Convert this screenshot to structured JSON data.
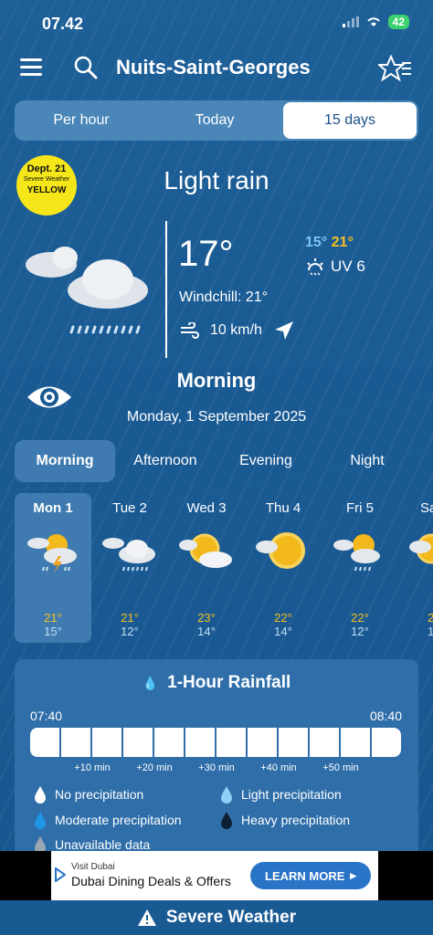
{
  "status": {
    "time": "07.42",
    "battery": "42"
  },
  "header": {
    "title": "Nuits-Saint-Georges"
  },
  "tabs": [
    "Per hour",
    "Today",
    "15 days"
  ],
  "badge": {
    "line1": "Dept. 21",
    "line2": "Severe Weather",
    "line3": "YELLOW",
    "color": "#f5e61a"
  },
  "current": {
    "condition": "Light rain",
    "temp": "17°",
    "min": "15°",
    "max": "21°",
    "uv": "UV 6",
    "windchill": "Windchill: 21°",
    "wind": "10 km/h"
  },
  "period": {
    "title": "Morning",
    "date": "Monday, 1 September 2025"
  },
  "period_tabs": [
    "Morning",
    "Afternoon",
    "Evening",
    "Night"
  ],
  "days": [
    {
      "name": "Mon 1",
      "max": "21°",
      "min": "15°",
      "icon": "storm-icon"
    },
    {
      "name": "Tue 2",
      "max": "21°",
      "min": "12°",
      "icon": "rain-cloud-icon"
    },
    {
      "name": "Wed 3",
      "max": "23°",
      "min": "14°",
      "icon": "partly-cloudy-icon"
    },
    {
      "name": "Thu 4",
      "max": "22°",
      "min": "14°",
      "icon": "sun-cloud-icon"
    },
    {
      "name": "Fri 5",
      "max": "22°",
      "min": "12°",
      "icon": "sun-rain-icon"
    },
    {
      "name": "Sa",
      "max": "2",
      "min": "1",
      "icon": "sun-cloud-icon"
    }
  ],
  "rainfall": {
    "title": "1-Hour Rainfall",
    "start": "07:40",
    "end": "08:40",
    "ticks": [
      "+10 min",
      "+20 min",
      "+30 min",
      "+40 min",
      "+50 min"
    ],
    "legend": [
      "No precipitation",
      "Light precipitation",
      "Moderate precipitation",
      "Heavy precipitation",
      "Unavailable data"
    ]
  },
  "ad": {
    "small": "Visit Dubai",
    "main": "Dubai Dining Deals & Offers",
    "button": "LEARN MORE"
  },
  "footer": {
    "label": "Severe Weather"
  },
  "colors": {
    "max": "#f7c021",
    "min_temp": "#79c6f0",
    "active": "#3f7bb0"
  }
}
